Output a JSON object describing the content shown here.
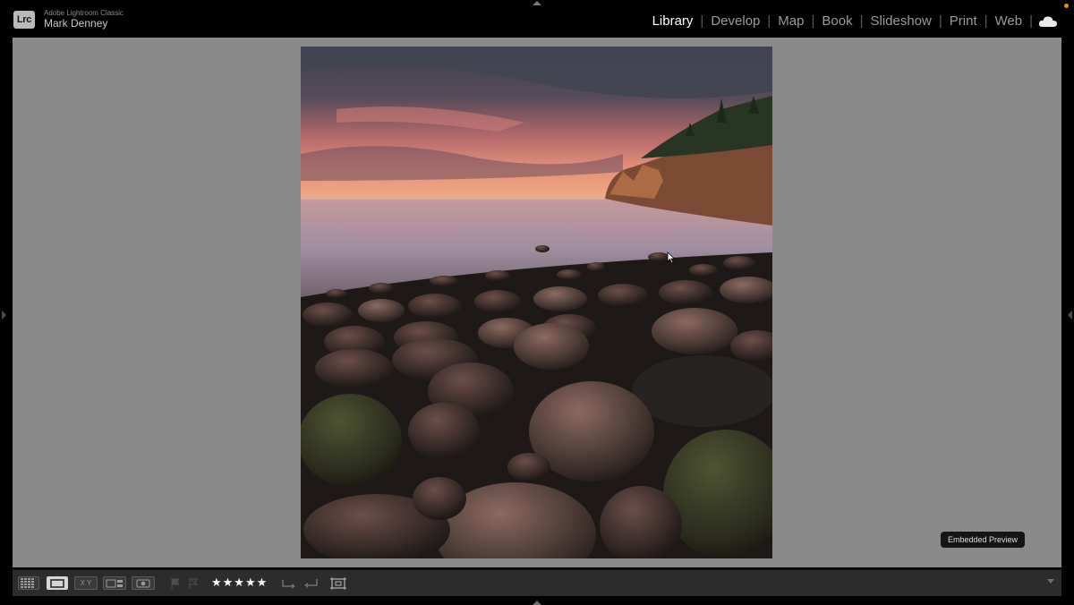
{
  "app": {
    "badge": "Lrc",
    "name": "Adobe Lightroom Classic",
    "user": "Mark Denney"
  },
  "modules": [
    {
      "label": "Library",
      "active": true
    },
    {
      "label": "Develop",
      "active": false
    },
    {
      "label": "Map",
      "active": false
    },
    {
      "label": "Book",
      "active": false
    },
    {
      "label": "Slideshow",
      "active": false
    },
    {
      "label": "Print",
      "active": false
    },
    {
      "label": "Web",
      "active": false
    }
  ],
  "status": {
    "embedded_preview": "Embedded Preview"
  },
  "toolbar": {
    "view_modes": [
      "grid-view-icon",
      "loupe-view-icon",
      "compare-view-icon",
      "survey-view-icon",
      "people-view-icon"
    ],
    "compare_label": "X Y",
    "rating": "★★★★★",
    "rating_value": 5
  },
  "icons": {
    "cloud": "cloud-sync-icon",
    "flag_pick": "flag-pick-icon",
    "flag_reject": "flag-reject-icon",
    "rotate_left": "rotate-left-icon",
    "rotate_right": "rotate-right-icon",
    "crop": "crop-overlay-icon"
  },
  "colors": {
    "background": "#000000",
    "canvas": "#8a8a8a",
    "toolbar": "#2c2c2c",
    "module_active": "#ffffff",
    "module_inactive": "#9a9a9a",
    "notification_dot": "#e2931d"
  }
}
